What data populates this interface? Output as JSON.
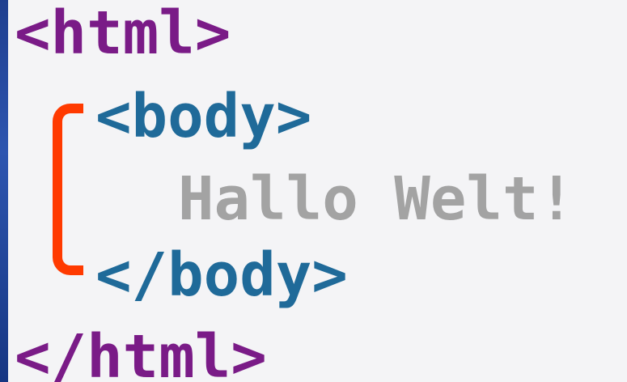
{
  "slide": {
    "lines": {
      "html_open": "<html>",
      "body_open": "<body>",
      "text": "Hallo Welt!",
      "body_close": "</body>",
      "html_close": "</html>"
    },
    "colors": {
      "html_tag": "#7a1b87",
      "body_tag": "#1f6a99",
      "text": "#a3a3a3",
      "bracket": "#ff3a00",
      "background": "#f4f4f6",
      "edge": "#2d55b0"
    },
    "icons": {
      "bracket": "nesting-bracket-icon"
    }
  }
}
